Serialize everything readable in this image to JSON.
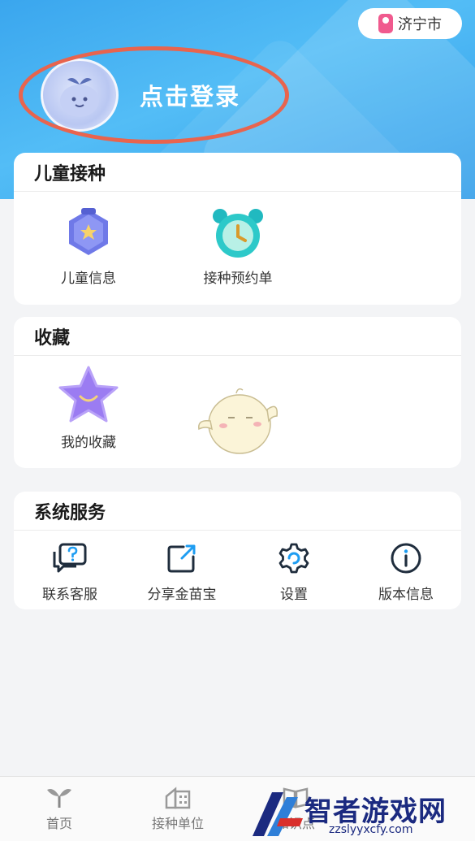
{
  "header": {
    "city": "济宁市",
    "login_label": "点击登录"
  },
  "vaccination": {
    "title": "儿童接种",
    "items": [
      {
        "label": "儿童信息",
        "icon": "child-info-badge-icon"
      },
      {
        "label": "接种预约单",
        "icon": "appointment-clock-icon"
      }
    ]
  },
  "favorites": {
    "title": "收藏",
    "items": [
      {
        "label": "我的收藏",
        "icon": "star-icon"
      }
    ]
  },
  "services": {
    "title": "系统服务",
    "items": [
      {
        "label": "联系客服",
        "icon": "customer-service-icon"
      },
      {
        "label": "分享金苗宝",
        "icon": "share-icon"
      },
      {
        "label": "设置",
        "icon": "gear-icon"
      },
      {
        "label": "版本信息",
        "icon": "info-icon"
      }
    ]
  },
  "tabbar": {
    "items": [
      {
        "label": "首页",
        "icon": "home-sprout-icon"
      },
      {
        "label": "接种单位",
        "icon": "building-icon"
      },
      {
        "label": "知识点",
        "icon": "book-icon"
      }
    ]
  },
  "watermark": {
    "main": "智者游戏网",
    "sub": "zzslyyxcfy.com"
  },
  "colors": {
    "accent_blue": "#3aa6ee",
    "login_ring": "#e8644e",
    "icon_dark": "#1f2d3d",
    "icon_share_accent": "#1e9df2"
  }
}
